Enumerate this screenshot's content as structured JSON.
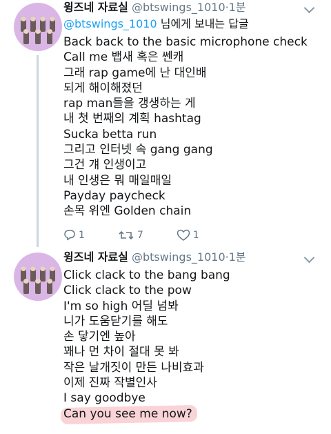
{
  "tweets": [
    {
      "author_name": "윙즈네 자료실",
      "handle": "@btswings_1010",
      "separator": "·",
      "time": "1분",
      "reply_to_mention": "@btswings_1010",
      "reply_to_text": " 님에게 보내는 답글",
      "lines": [
        "Back back to the basic microphone check",
        "Call me 뱁새 혹은 쎈캐",
        "그래 rap game에 난 대인배",
        "되게 해이해졌던",
        "rap man들을 갱생하는 게",
        "내 첫 번째의 계획 hashtag",
        "Sucka betta run",
        "그리고 인터넷 속 gang gang",
        "그건 걔 인생이고",
        "내 인생은 뭐 매일매일",
        "Payday paycheck",
        "손목 위엔 Golden chain"
      ],
      "actions": {
        "reply_count": "1",
        "retweet_count": "7",
        "like_count": "1"
      }
    },
    {
      "author_name": "윙즈네 자료실",
      "handle": "@btswings_1010",
      "separator": "·",
      "time": "1분",
      "lines": [
        "Click clack to the bang bang",
        "Click clack to the pow",
        "I'm so high 어딜 넘봐",
        "니가 도움닫기를 해도",
        "손 닿기엔 높아",
        "꽤나 먼 차이 절대 못 봐",
        "작은 날개짓이 만든 나비효과",
        "이제 진짜 작별인사",
        "I say goodbye",
        "Can you see me now?"
      ]
    }
  ],
  "colors": {
    "link": "#1da1f2",
    "muted": "#657786",
    "avatar_bg": "#d9b6e6",
    "highlight": "#f0828c"
  },
  "icons": [
    "reply-icon",
    "retweet-icon",
    "like-icon",
    "chevron-down-icon"
  ]
}
